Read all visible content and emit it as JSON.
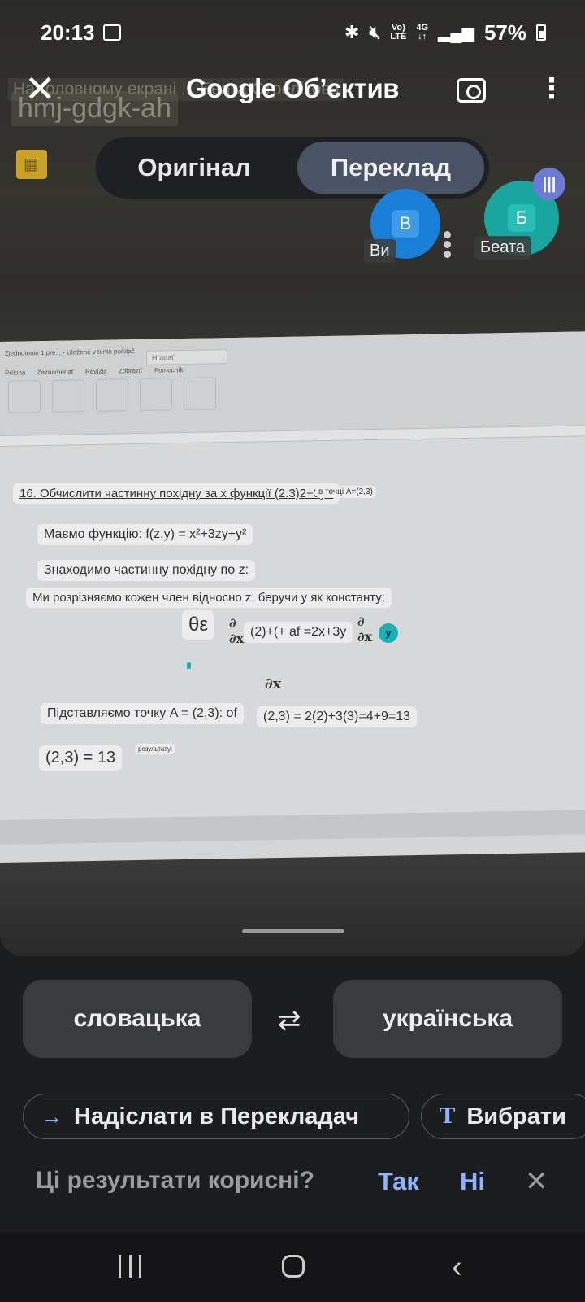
{
  "status_bar": {
    "time": "20:13",
    "network_top": "Vo)",
    "network_bottom": "LTE",
    "lte_top": "4G",
    "lte_bottom": "↓↑",
    "battery": "57%"
  },
  "header": {
    "title": "Google Об’єктив",
    "background_text_1": "На головному екрані ... Беата Стрелікова",
    "background_text_2": "hmj-gdgk-ah"
  },
  "mode_toggle": {
    "original_label": "Оригінал",
    "translate_label": "Переклад",
    "active": "Переклад"
  },
  "participants": {
    "you_initial": "В",
    "you_label": "Ви",
    "other_initial": "Б",
    "other_label": "Беата"
  },
  "document": {
    "search_placeholder": "Hľadať",
    "ribbon_top": "Zjednotenie 1 pre... • Uložené v tento počítač",
    "ribbon_tabs": "Príloha Zaznamenať Revízia Zobraziť Pomocník",
    "overlays": {
      "task": "16. Обчислити частинну похідну за x функції (2.3)2+3y+",
      "task_tail": "в точці A=(2,3)",
      "line1": "Маємо функцію: f(z,y) = x²+3zy+y²",
      "line2": "Знаходимо частинну похідну по z:",
      "line3": "Ми розрізняємо кожен член відносно z, беручи у як константу:",
      "formula_theta": "θε",
      "formula_mid": "(2)+(+ af =2x+3y",
      "formula_dx": "∂x",
      "line4": "Підставляємо точку A = (2,3): of",
      "line4_tail": "(2,3) = 2(2)+3(3)=4+9=13",
      "result": "(2,3) = 13",
      "result_tag": "результату:"
    }
  },
  "languages": {
    "source": "словацька",
    "target": "українська"
  },
  "actions": {
    "send_label": "Надіслати в Перекладач",
    "select_label": "Вибрати"
  },
  "feedback": {
    "question": "Ці результати корисні?",
    "yes": "Так",
    "no": "Ні"
  },
  "icons": [
    "close-icon",
    "camera-icon",
    "more-vert-icon",
    "swap-icon",
    "arrow-right-icon",
    "text-select-icon",
    "close-feedback-icon",
    "recent-apps-icon",
    "home-icon",
    "back-icon"
  ]
}
